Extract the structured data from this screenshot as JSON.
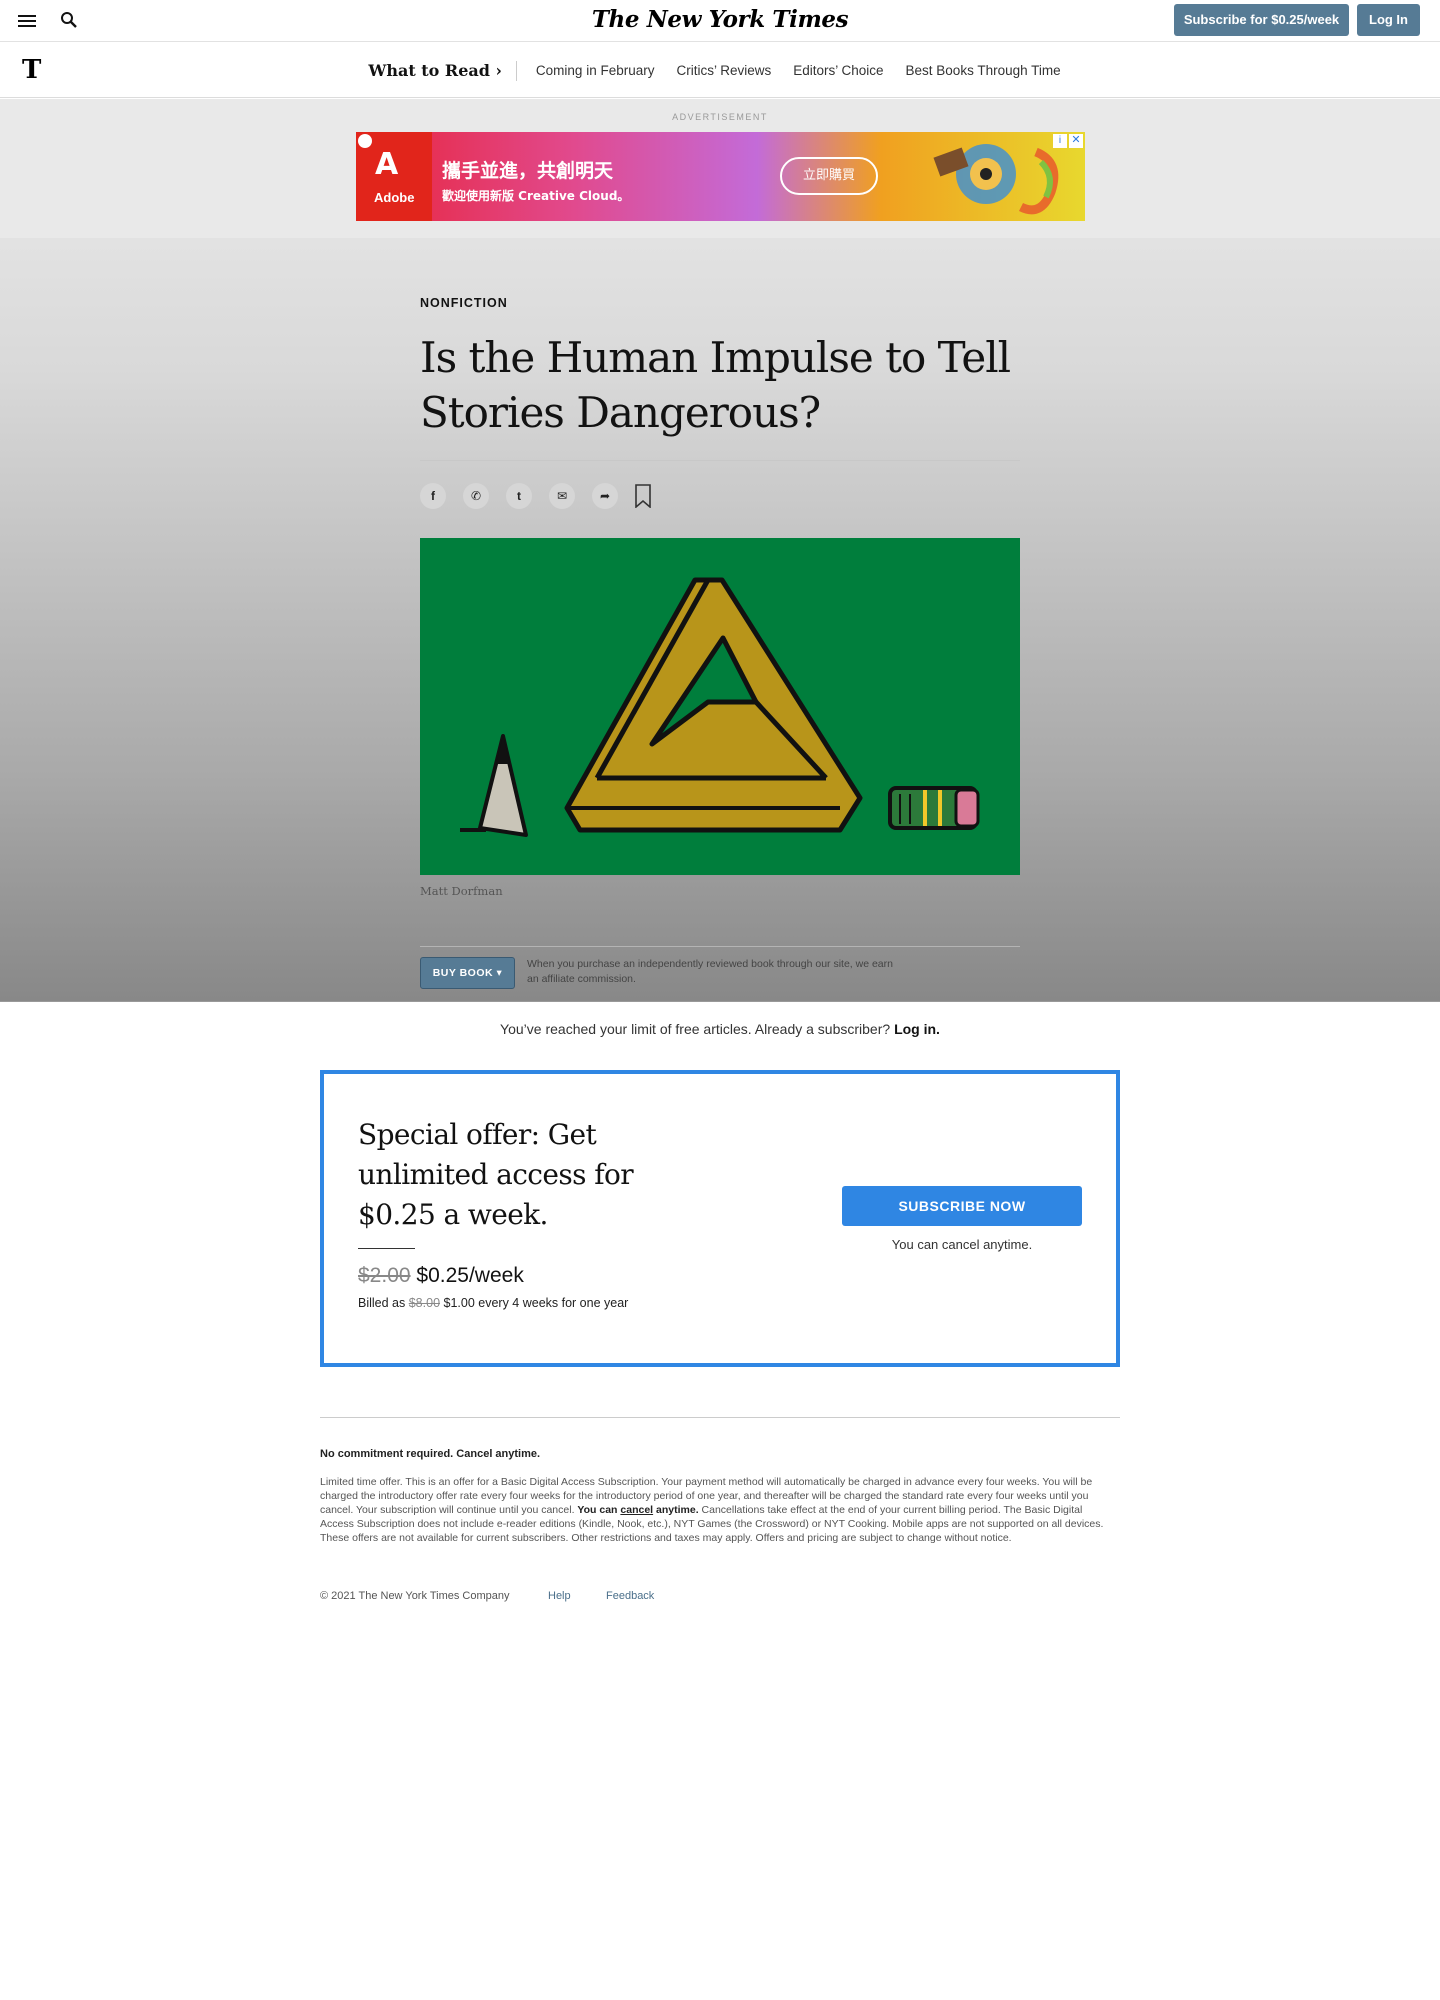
{
  "masthead": {
    "logo": "The New York Times",
    "subscribe_label": "Subscribe for $0.25/week",
    "login_label": "Log In"
  },
  "section_nav": {
    "logo_mark": "T",
    "title": "What to Read ›",
    "items": [
      "Coming in February",
      "Critics’ Reviews",
      "Editors’ Choice",
      "Best Books Through Time"
    ]
  },
  "ad": {
    "label": "ADVERTISEMENT",
    "brand_mark": "A",
    "brand": "Adobe",
    "headline": "攜手並進，共創明天",
    "subline": "歡迎使用新版 Creative Cloud。",
    "cta": "立即購買",
    "info_glyph": "i",
    "close_glyph": "✕"
  },
  "article": {
    "kicker": "NONFICTION",
    "headline": "Is the Human Impulse to Tell Stories Dangerous?",
    "share_icons": [
      "facebook-icon",
      "whatsapp-icon",
      "twitter-icon",
      "email-icon",
      "share-icon",
      "bookmark-icon"
    ],
    "share_glyphs": [
      "f",
      "✆",
      "t",
      "✉",
      "➦"
    ],
    "image_credit": "Matt Dorfman",
    "buy_book_label": "BUY BOOK ▾",
    "affiliate_note": "When you purchase an independently reviewed book through our site, we earn an affiliate commission."
  },
  "paywall": {
    "limit_text": "You’ve reached your limit of free articles. Already a subscriber? ",
    "limit_link": "Log in.",
    "offer_title": "Special offer: Get unlimited access for $0.25 a week.",
    "price_old": "$2.00",
    "price_new": "$0.25/week",
    "billed_prefix": "Billed as ",
    "billed_old": "$8.00",
    "billed_new": "$1.00 every 4 weeks for one year",
    "cta_label": "SUBSCRIBE NOW",
    "cancel_note": "You can cancel anytime."
  },
  "footer": {
    "no_commitment": "No commitment required. Cancel anytime.",
    "legal_a": "Limited time offer. This is an offer for a Basic Digital Access Subscription. Your payment method will automatically be charged in advance every four weeks. You will be charged the introductory offer rate every four weeks for the introductory period of one year, and thereafter will be charged the standard rate every four weeks until you cancel. Your subscription will continue until you cancel. ",
    "legal_bold_1": "You can ",
    "legal_bold_link": "cancel",
    "legal_bold_2": " anytime.",
    "legal_b": " Cancellations take effect at the end of your current billing period. The Basic Digital Access Subscription does not include e-reader editions (Kindle, Nook, etc.), NYT Games (the Crossword) or NYT Cooking. Mobile apps are not supported on all devices. These offers are not available for current subscribers. Other restrictions and taxes may apply. Offers and pricing are subject to change without notice.",
    "copyright": "© 2021 The New York Times Company",
    "help": "Help",
    "feedback": "Feedback"
  },
  "colors": {
    "accent_blue": "#2f86e3",
    "nyt_button": "#567b95",
    "illustration_green": "#007e3c",
    "illustration_gold": "#b8951a"
  }
}
